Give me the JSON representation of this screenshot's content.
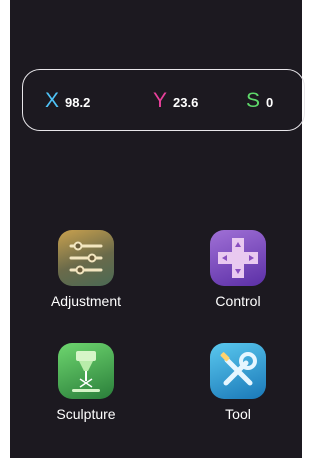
{
  "coordinates": {
    "x": {
      "axis": "X",
      "value": "98.2"
    },
    "y": {
      "axis": "Y",
      "value": "23.6"
    },
    "s": {
      "axis": "S",
      "value": "0"
    }
  },
  "apps": [
    {
      "label": "Adjustment",
      "icon": "sliders-icon"
    },
    {
      "label": "Control",
      "icon": "dpad-icon"
    },
    {
      "label": "Sculpture",
      "icon": "laser-engraver-icon"
    },
    {
      "label": "Tool",
      "icon": "wrench-screwdriver-icon"
    }
  ],
  "colors": {
    "background": "#1c1920",
    "x_axis": "#4fc3f7",
    "y_axis": "#e8409a",
    "s_axis": "#5ed86a"
  }
}
